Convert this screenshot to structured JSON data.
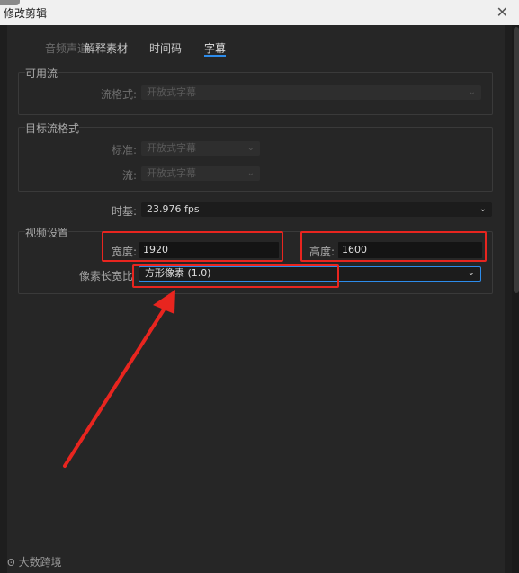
{
  "window": {
    "title": "修改剪辑",
    "close_icon": "✕"
  },
  "tabs": [
    {
      "label": "音频声道",
      "state": "disabled"
    },
    {
      "label": "解释素材",
      "state": "normal"
    },
    {
      "label": "时间码",
      "state": "normal"
    },
    {
      "label": "字幕",
      "state": "active"
    }
  ],
  "available_streams": {
    "group_label": "可用流",
    "stream_format_label": "流格式:",
    "stream_format_value": "开放式字幕"
  },
  "target_stream_format": {
    "group_label": "目标流格式",
    "standard_label": "标准:",
    "standard_value": "开放式字幕",
    "stream_label": "流:",
    "stream_value": "开放式字幕"
  },
  "timebase": {
    "label": "时基:",
    "value": "23.976 fps"
  },
  "video_settings": {
    "group_label": "视频设置",
    "width_label": "宽度:",
    "width_value": "1920",
    "height_label": "高度:",
    "height_value": "1600",
    "pixel_aspect_label": "像素长宽比",
    "pixel_aspect_value": "方形像素 (1.0)"
  },
  "annotations": {
    "color": "#e8251f"
  },
  "watermark": {
    "logo": "Ꙩ",
    "text": "大数跨境"
  },
  "icons": {
    "chevron": "chevron-down-icon",
    "close": "close-icon"
  }
}
